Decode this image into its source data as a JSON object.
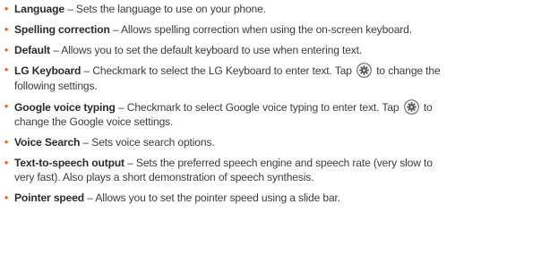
{
  "items": [
    {
      "term": "Language",
      "desc": " – Sets the language to use on your phone."
    },
    {
      "term": "Spelling correction",
      "desc": " – Allows spelling correction when using the on-screen keyboard."
    },
    {
      "term": "Default",
      "desc": " – Allows you to set the default keyboard to use when entering text."
    },
    {
      "term": "LG Keyboard",
      "desc_before_icon": " – Checkmark to select the LG Keyboard to enter text. Tap ",
      "desc_after_icon": " to change the",
      "desc_line2": "following settings.",
      "icon": "gear-icon"
    },
    {
      "term": "Google voice typing",
      "desc_before_icon": " – Checkmark to select Google voice typing to enter text. Tap ",
      "desc_after_icon": " to",
      "desc_line2": "change the Google voice settings.",
      "icon": "gear-icon"
    },
    {
      "term": "Voice Search",
      "desc": " – Sets voice search options."
    },
    {
      "term": "Text-to-speech output",
      "desc_line1": " – Sets the preferred speech engine and speech rate (very slow to",
      "desc_line2": "very fast). Also plays a short demonstration of speech synthesis."
    },
    {
      "term": "Pointer speed",
      "desc": " – Allows you to set the pointer speed using a slide bar."
    }
  ],
  "colors": {
    "bullet": "#e5621a",
    "text": "#3c3c3c",
    "term": "#2b2b2b"
  }
}
